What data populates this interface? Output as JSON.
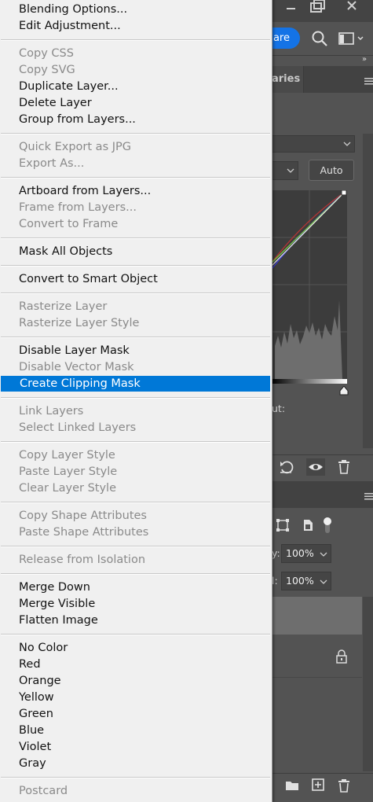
{
  "menu": {
    "groups": [
      {
        "items": [
          {
            "label": "Blending Options...",
            "enabled": true
          },
          {
            "label": "Edit Adjustment...",
            "enabled": true
          }
        ]
      },
      {
        "items": [
          {
            "label": "Copy CSS",
            "enabled": false
          },
          {
            "label": "Copy SVG",
            "enabled": false
          },
          {
            "label": "Duplicate Layer...",
            "enabled": true
          },
          {
            "label": "Delete Layer",
            "enabled": true
          },
          {
            "label": "Group from Layers...",
            "enabled": true
          }
        ]
      },
      {
        "items": [
          {
            "label": "Quick Export as JPG",
            "enabled": false
          },
          {
            "label": "Export As...",
            "enabled": false
          }
        ]
      },
      {
        "items": [
          {
            "label": "Artboard from Layers...",
            "enabled": true
          },
          {
            "label": "Frame from Layers...",
            "enabled": false
          },
          {
            "label": "Convert to Frame",
            "enabled": false
          }
        ]
      },
      {
        "items": [
          {
            "label": "Mask All Objects",
            "enabled": true
          }
        ]
      },
      {
        "items": [
          {
            "label": "Convert to Smart Object",
            "enabled": true
          }
        ]
      },
      {
        "items": [
          {
            "label": "Rasterize Layer",
            "enabled": false
          },
          {
            "label": "Rasterize Layer Style",
            "enabled": false
          }
        ]
      },
      {
        "items": [
          {
            "label": "Disable Layer Mask",
            "enabled": true
          },
          {
            "label": "Disable Vector Mask",
            "enabled": false
          },
          {
            "label": "Create Clipping Mask",
            "enabled": true,
            "highlighted": true
          }
        ]
      },
      {
        "items": [
          {
            "label": "Link Layers",
            "enabled": false
          },
          {
            "label": "Select Linked Layers",
            "enabled": false
          }
        ]
      },
      {
        "items": [
          {
            "label": "Copy Layer Style",
            "enabled": false
          },
          {
            "label": "Paste Layer Style",
            "enabled": false
          },
          {
            "label": "Clear Layer Style",
            "enabled": false
          }
        ]
      },
      {
        "items": [
          {
            "label": "Copy Shape Attributes",
            "enabled": false
          },
          {
            "label": "Paste Shape Attributes",
            "enabled": false
          }
        ]
      },
      {
        "items": [
          {
            "label": "Release from Isolation",
            "enabled": false
          }
        ]
      },
      {
        "items": [
          {
            "label": "Merge Down",
            "enabled": true
          },
          {
            "label": "Merge Visible",
            "enabled": true
          },
          {
            "label": "Flatten Image",
            "enabled": true
          }
        ]
      },
      {
        "items": [
          {
            "label": "No Color",
            "enabled": true
          },
          {
            "label": "Red",
            "enabled": true
          },
          {
            "label": "Orange",
            "enabled": true
          },
          {
            "label": "Yellow",
            "enabled": true
          },
          {
            "label": "Green",
            "enabled": true
          },
          {
            "label": "Blue",
            "enabled": true
          },
          {
            "label": "Violet",
            "enabled": true
          },
          {
            "label": "Gray",
            "enabled": true
          }
        ]
      },
      {
        "items": [
          {
            "label": "Postcard",
            "enabled": false
          }
        ]
      }
    ]
  },
  "app": {
    "share_label": "are",
    "libraries_tab": "aries",
    "properties": {
      "auto_button": "Auto",
      "input_label": "ut:"
    },
    "layers": {
      "opacity_label": "y:",
      "opacity_value": "100%",
      "fill_label": "l:",
      "fill_value": "100%"
    },
    "colors": {
      "accent": "#0078d7",
      "share_button": "#1473e6",
      "panel_bg": "#535353",
      "menu_bg": "#f0f0f0"
    },
    "icons": [
      "minimize-icon",
      "restore-icon",
      "close-icon",
      "search-icon",
      "workspace-icon",
      "collapse-icon",
      "panel-menu-icon",
      "reset-icon",
      "visibility-icon",
      "trash-icon",
      "transform-icon",
      "document-icon",
      "toggle-icon",
      "lock-icon",
      "folder-icon",
      "add-layer-icon"
    ]
  }
}
